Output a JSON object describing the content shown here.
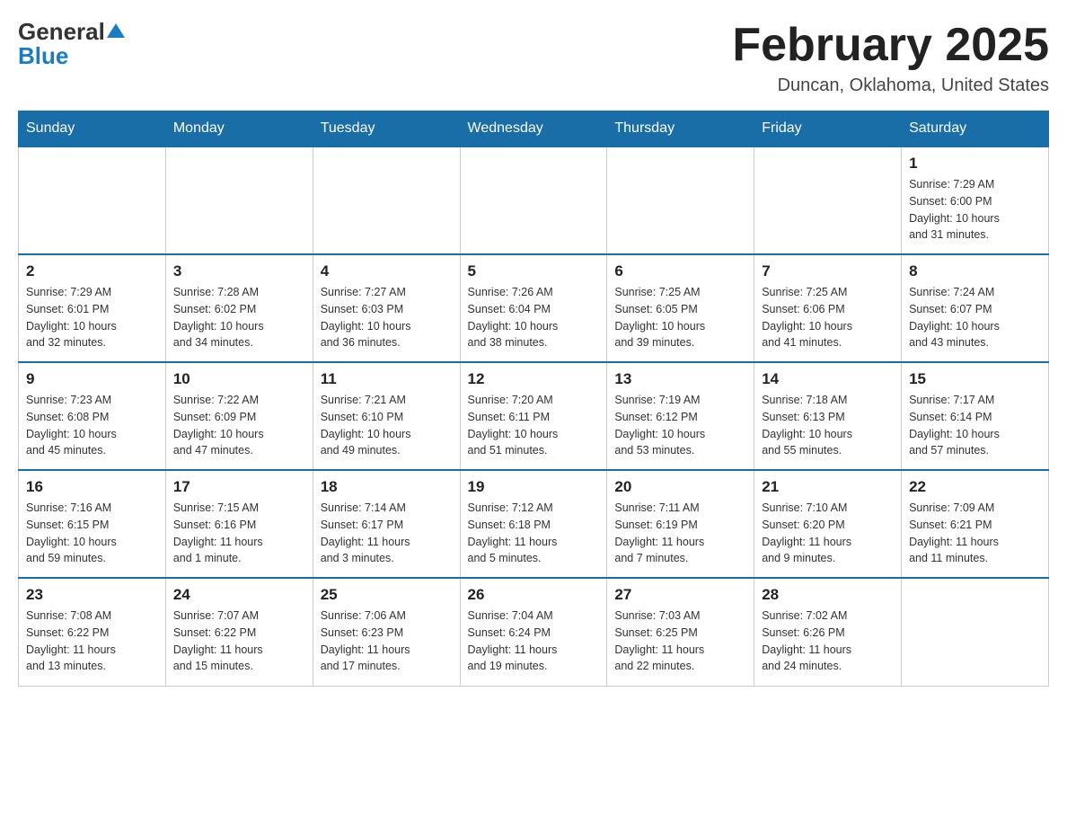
{
  "header": {
    "logo_general": "General",
    "logo_blue": "Blue",
    "title": "February 2025",
    "location": "Duncan, Oklahoma, United States"
  },
  "days_of_week": [
    "Sunday",
    "Monday",
    "Tuesday",
    "Wednesday",
    "Thursday",
    "Friday",
    "Saturday"
  ],
  "weeks": [
    [
      {
        "day": "",
        "info": ""
      },
      {
        "day": "",
        "info": ""
      },
      {
        "day": "",
        "info": ""
      },
      {
        "day": "",
        "info": ""
      },
      {
        "day": "",
        "info": ""
      },
      {
        "day": "",
        "info": ""
      },
      {
        "day": "1",
        "info": "Sunrise: 7:29 AM\nSunset: 6:00 PM\nDaylight: 10 hours\nand 31 minutes."
      }
    ],
    [
      {
        "day": "2",
        "info": "Sunrise: 7:29 AM\nSunset: 6:01 PM\nDaylight: 10 hours\nand 32 minutes."
      },
      {
        "day": "3",
        "info": "Sunrise: 7:28 AM\nSunset: 6:02 PM\nDaylight: 10 hours\nand 34 minutes."
      },
      {
        "day": "4",
        "info": "Sunrise: 7:27 AM\nSunset: 6:03 PM\nDaylight: 10 hours\nand 36 minutes."
      },
      {
        "day": "5",
        "info": "Sunrise: 7:26 AM\nSunset: 6:04 PM\nDaylight: 10 hours\nand 38 minutes."
      },
      {
        "day": "6",
        "info": "Sunrise: 7:25 AM\nSunset: 6:05 PM\nDaylight: 10 hours\nand 39 minutes."
      },
      {
        "day": "7",
        "info": "Sunrise: 7:25 AM\nSunset: 6:06 PM\nDaylight: 10 hours\nand 41 minutes."
      },
      {
        "day": "8",
        "info": "Sunrise: 7:24 AM\nSunset: 6:07 PM\nDaylight: 10 hours\nand 43 minutes."
      }
    ],
    [
      {
        "day": "9",
        "info": "Sunrise: 7:23 AM\nSunset: 6:08 PM\nDaylight: 10 hours\nand 45 minutes."
      },
      {
        "day": "10",
        "info": "Sunrise: 7:22 AM\nSunset: 6:09 PM\nDaylight: 10 hours\nand 47 minutes."
      },
      {
        "day": "11",
        "info": "Sunrise: 7:21 AM\nSunset: 6:10 PM\nDaylight: 10 hours\nand 49 minutes."
      },
      {
        "day": "12",
        "info": "Sunrise: 7:20 AM\nSunset: 6:11 PM\nDaylight: 10 hours\nand 51 minutes."
      },
      {
        "day": "13",
        "info": "Sunrise: 7:19 AM\nSunset: 6:12 PM\nDaylight: 10 hours\nand 53 minutes."
      },
      {
        "day": "14",
        "info": "Sunrise: 7:18 AM\nSunset: 6:13 PM\nDaylight: 10 hours\nand 55 minutes."
      },
      {
        "day": "15",
        "info": "Sunrise: 7:17 AM\nSunset: 6:14 PM\nDaylight: 10 hours\nand 57 minutes."
      }
    ],
    [
      {
        "day": "16",
        "info": "Sunrise: 7:16 AM\nSunset: 6:15 PM\nDaylight: 10 hours\nand 59 minutes."
      },
      {
        "day": "17",
        "info": "Sunrise: 7:15 AM\nSunset: 6:16 PM\nDaylight: 11 hours\nand 1 minute."
      },
      {
        "day": "18",
        "info": "Sunrise: 7:14 AM\nSunset: 6:17 PM\nDaylight: 11 hours\nand 3 minutes."
      },
      {
        "day": "19",
        "info": "Sunrise: 7:12 AM\nSunset: 6:18 PM\nDaylight: 11 hours\nand 5 minutes."
      },
      {
        "day": "20",
        "info": "Sunrise: 7:11 AM\nSunset: 6:19 PM\nDaylight: 11 hours\nand 7 minutes."
      },
      {
        "day": "21",
        "info": "Sunrise: 7:10 AM\nSunset: 6:20 PM\nDaylight: 11 hours\nand 9 minutes."
      },
      {
        "day": "22",
        "info": "Sunrise: 7:09 AM\nSunset: 6:21 PM\nDaylight: 11 hours\nand 11 minutes."
      }
    ],
    [
      {
        "day": "23",
        "info": "Sunrise: 7:08 AM\nSunset: 6:22 PM\nDaylight: 11 hours\nand 13 minutes."
      },
      {
        "day": "24",
        "info": "Sunrise: 7:07 AM\nSunset: 6:22 PM\nDaylight: 11 hours\nand 15 minutes."
      },
      {
        "day": "25",
        "info": "Sunrise: 7:06 AM\nSunset: 6:23 PM\nDaylight: 11 hours\nand 17 minutes."
      },
      {
        "day": "26",
        "info": "Sunrise: 7:04 AM\nSunset: 6:24 PM\nDaylight: 11 hours\nand 19 minutes."
      },
      {
        "day": "27",
        "info": "Sunrise: 7:03 AM\nSunset: 6:25 PM\nDaylight: 11 hours\nand 22 minutes."
      },
      {
        "day": "28",
        "info": "Sunrise: 7:02 AM\nSunset: 6:26 PM\nDaylight: 11 hours\nand 24 minutes."
      },
      {
        "day": "",
        "info": ""
      }
    ]
  ]
}
